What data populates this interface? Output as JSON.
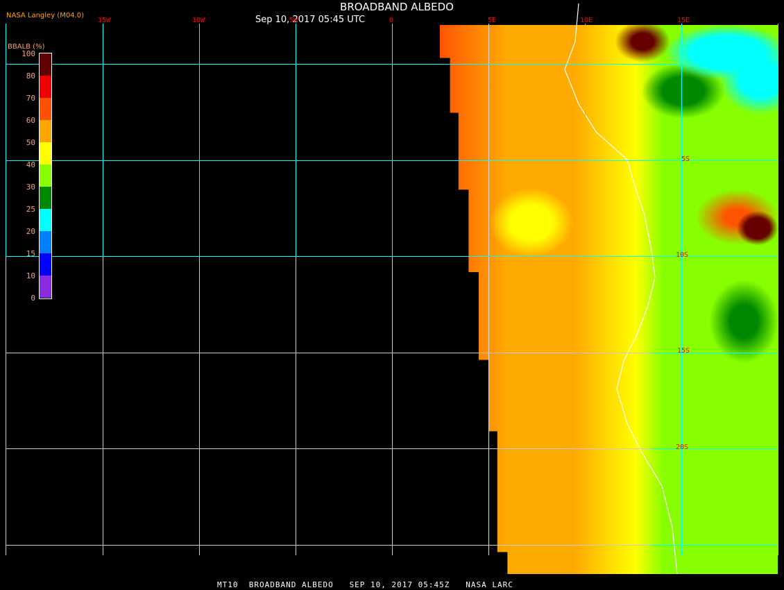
{
  "header": {
    "title": "BROADBAND ALBEDO",
    "subtitle": "Sep 10, 2017 05:45 UTC",
    "credit": "NASA Langley (M04.0)"
  },
  "footer": "MT10  BROADBAND ALBEDO   SEP 10, 2017 05:45Z   NASA LARC",
  "longitude_labels": [
    "15W",
    "10W",
    "5W",
    "0",
    "5E",
    "10E",
    "15E"
  ],
  "latitude_labels": [
    "5S",
    "10S",
    "15S",
    "20S"
  ],
  "colorbar": {
    "title": "BBALB (%)",
    "ticks": [
      "100",
      "80",
      "70",
      "60",
      "50",
      "40",
      "30",
      "25",
      "20",
      "15",
      "10",
      "0"
    ],
    "colors": [
      "#600000",
      "#f00000",
      "#ff5000",
      "#ffa500",
      "#ffff00",
      "#88ff00",
      "#008800",
      "#00ffff",
      "#0080ff",
      "#0000ff",
      "#8a2be2"
    ]
  }
}
